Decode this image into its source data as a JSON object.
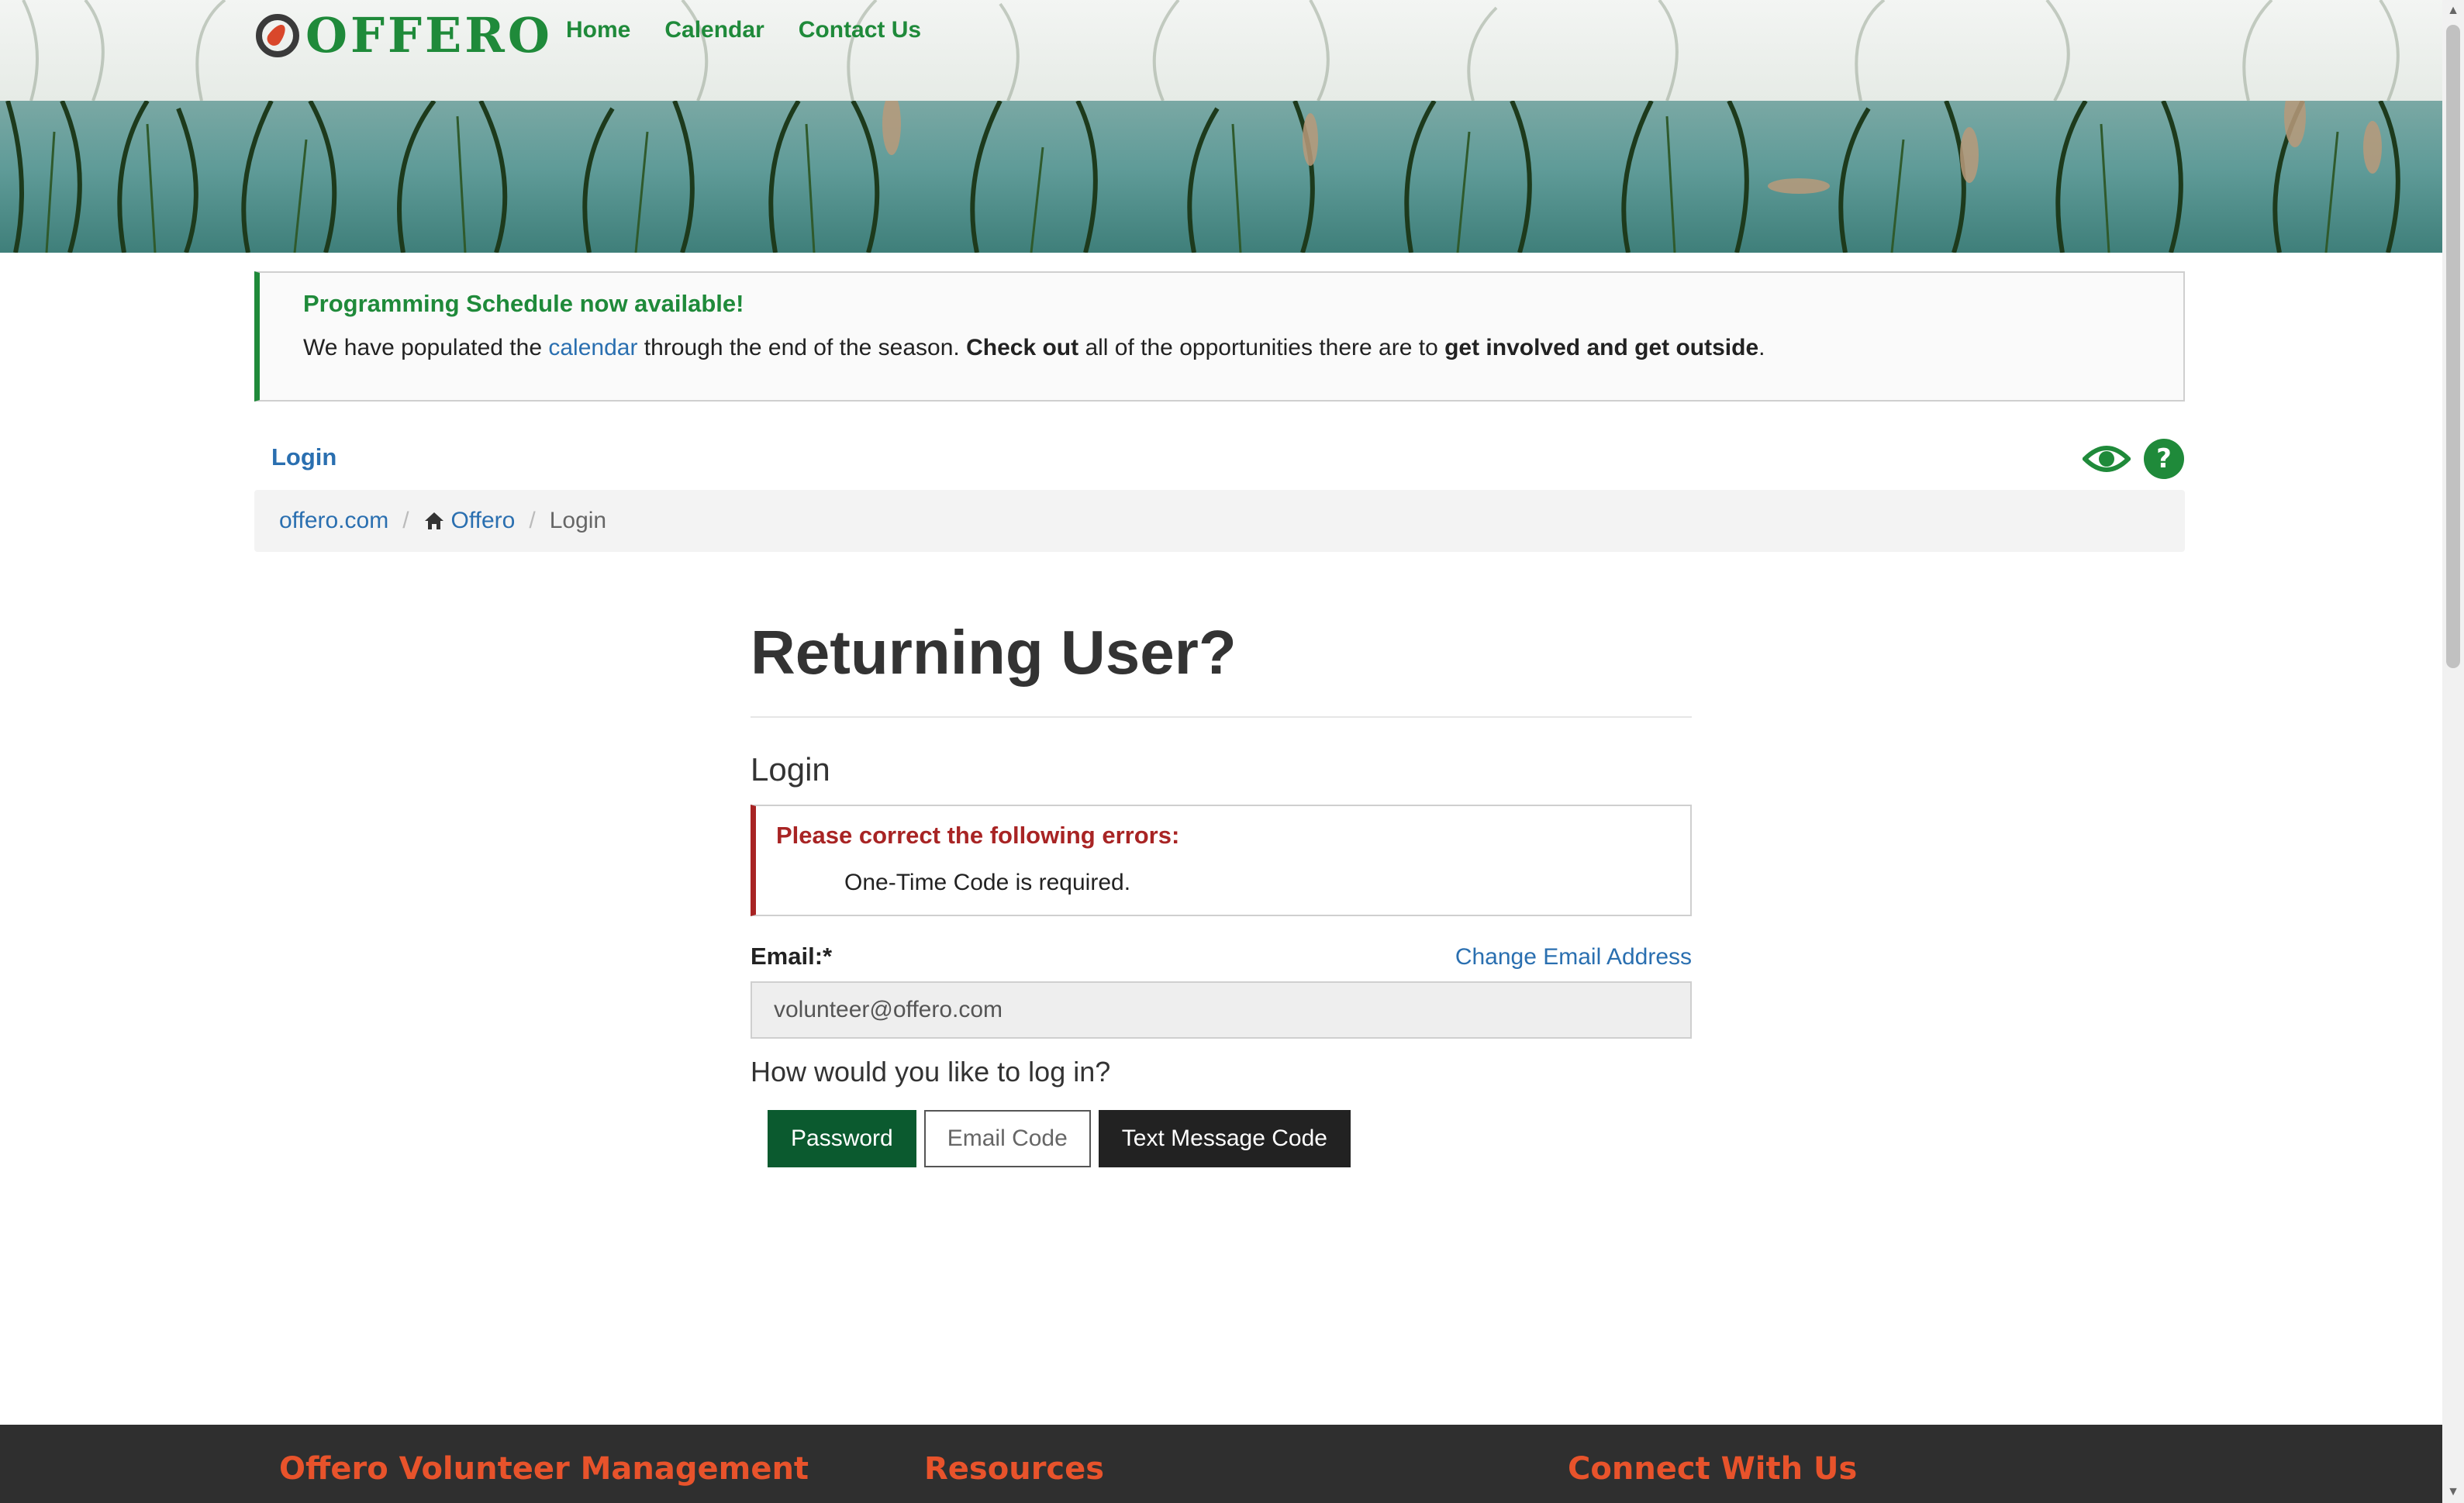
{
  "header": {
    "logo_text": "OFFERO",
    "nav": [
      "Home",
      "Calendar",
      "Contact Us"
    ]
  },
  "announcement": {
    "title": "Programming Schedule now available!",
    "body_1": "We have populated the ",
    "link": "calendar",
    "body_2": " through the end of the season. ",
    "bold_1": "Check out",
    "body_3": " all of the opportunities there are to ",
    "bold_2": "get involved and get outside",
    "body_4": "."
  },
  "page": {
    "title": "Login",
    "tools": [
      "eye-icon",
      "help-icon"
    ]
  },
  "breadcrumb": {
    "site": "offero.com",
    "home": "Offero",
    "current": "Login",
    "separator": "/"
  },
  "main": {
    "heading": "Returning User?",
    "subheading": "Login",
    "error_title": "Please correct the following errors:",
    "error_item": "One-Time Code is required.",
    "email_label": "Email:*",
    "change_email": "Change Email Address",
    "email_value": "volunteer@offero.com",
    "question": "How would you like to log in?",
    "buttons": {
      "password": "Password",
      "email_code": "Email Code",
      "text_code": "Text Message Code"
    }
  },
  "footer": {
    "col1": "Offero Volunteer Management",
    "col2": "Resources",
    "col3": "Connect With Us"
  },
  "colors": {
    "brand_green": "#1f8a3a",
    "dark_green": "#0b5a2f",
    "link_blue": "#2a6fb0",
    "error_red": "#a82424",
    "footer_orange": "#e8532b"
  }
}
